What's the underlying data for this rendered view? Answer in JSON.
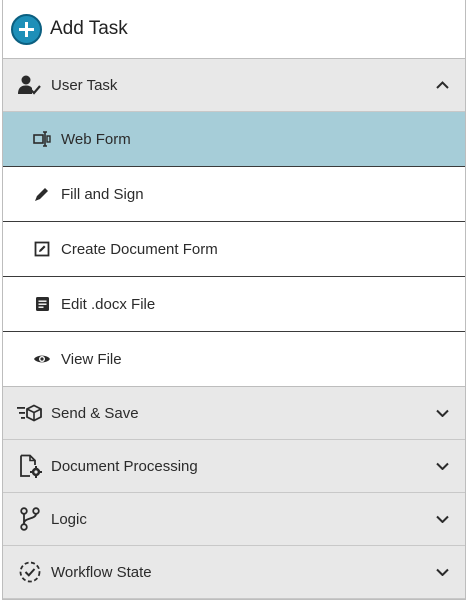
{
  "header": {
    "title": "Add Task",
    "accent": "#1d8fb8"
  },
  "sections": [
    {
      "label": "User Task",
      "icon": "user-check-icon",
      "expanded": true,
      "items": [
        {
          "label": "Web Form",
          "icon": "web-form-icon",
          "active": true
        },
        {
          "label": "Fill and Sign",
          "icon": "pen-icon"
        },
        {
          "label": "Create Document Form",
          "icon": "edit-box-icon"
        },
        {
          "label": "Edit .docx File",
          "icon": "document-icon"
        },
        {
          "label": "View File",
          "icon": "eye-icon"
        }
      ]
    },
    {
      "label": "Send & Save",
      "icon": "send-package-icon",
      "expanded": false
    },
    {
      "label": "Document Processing",
      "icon": "document-gear-icon",
      "expanded": false
    },
    {
      "label": "Logic",
      "icon": "branch-icon",
      "expanded": false
    },
    {
      "label": "Workflow State",
      "icon": "workflow-state-icon",
      "expanded": false
    }
  ],
  "colors": {
    "active_item_bg": "#a6cdd8",
    "section_bg": "#e8e8e8"
  }
}
